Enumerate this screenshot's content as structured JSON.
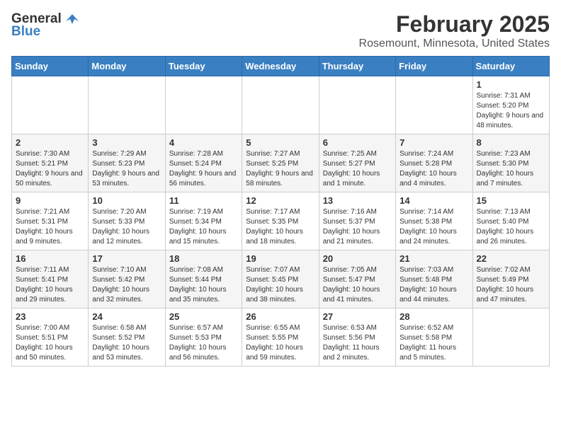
{
  "logo": {
    "general": "General",
    "blue": "Blue"
  },
  "title": "February 2025",
  "subtitle": "Rosemount, Minnesota, United States",
  "days_of_week": [
    "Sunday",
    "Monday",
    "Tuesday",
    "Wednesday",
    "Thursday",
    "Friday",
    "Saturday"
  ],
  "weeks": [
    [
      {
        "day": "",
        "info": ""
      },
      {
        "day": "",
        "info": ""
      },
      {
        "day": "",
        "info": ""
      },
      {
        "day": "",
        "info": ""
      },
      {
        "day": "",
        "info": ""
      },
      {
        "day": "",
        "info": ""
      },
      {
        "day": "1",
        "info": "Sunrise: 7:31 AM\nSunset: 5:20 PM\nDaylight: 9 hours and 48 minutes."
      }
    ],
    [
      {
        "day": "2",
        "info": "Sunrise: 7:30 AM\nSunset: 5:21 PM\nDaylight: 9 hours and 50 minutes."
      },
      {
        "day": "3",
        "info": "Sunrise: 7:29 AM\nSunset: 5:23 PM\nDaylight: 9 hours and 53 minutes."
      },
      {
        "day": "4",
        "info": "Sunrise: 7:28 AM\nSunset: 5:24 PM\nDaylight: 9 hours and 56 minutes."
      },
      {
        "day": "5",
        "info": "Sunrise: 7:27 AM\nSunset: 5:25 PM\nDaylight: 9 hours and 58 minutes."
      },
      {
        "day": "6",
        "info": "Sunrise: 7:25 AM\nSunset: 5:27 PM\nDaylight: 10 hours and 1 minute."
      },
      {
        "day": "7",
        "info": "Sunrise: 7:24 AM\nSunset: 5:28 PM\nDaylight: 10 hours and 4 minutes."
      },
      {
        "day": "8",
        "info": "Sunrise: 7:23 AM\nSunset: 5:30 PM\nDaylight: 10 hours and 7 minutes."
      }
    ],
    [
      {
        "day": "9",
        "info": "Sunrise: 7:21 AM\nSunset: 5:31 PM\nDaylight: 10 hours and 9 minutes."
      },
      {
        "day": "10",
        "info": "Sunrise: 7:20 AM\nSunset: 5:33 PM\nDaylight: 10 hours and 12 minutes."
      },
      {
        "day": "11",
        "info": "Sunrise: 7:19 AM\nSunset: 5:34 PM\nDaylight: 10 hours and 15 minutes."
      },
      {
        "day": "12",
        "info": "Sunrise: 7:17 AM\nSunset: 5:35 PM\nDaylight: 10 hours and 18 minutes."
      },
      {
        "day": "13",
        "info": "Sunrise: 7:16 AM\nSunset: 5:37 PM\nDaylight: 10 hours and 21 minutes."
      },
      {
        "day": "14",
        "info": "Sunrise: 7:14 AM\nSunset: 5:38 PM\nDaylight: 10 hours and 24 minutes."
      },
      {
        "day": "15",
        "info": "Sunrise: 7:13 AM\nSunset: 5:40 PM\nDaylight: 10 hours and 26 minutes."
      }
    ],
    [
      {
        "day": "16",
        "info": "Sunrise: 7:11 AM\nSunset: 5:41 PM\nDaylight: 10 hours and 29 minutes."
      },
      {
        "day": "17",
        "info": "Sunrise: 7:10 AM\nSunset: 5:42 PM\nDaylight: 10 hours and 32 minutes."
      },
      {
        "day": "18",
        "info": "Sunrise: 7:08 AM\nSunset: 5:44 PM\nDaylight: 10 hours and 35 minutes."
      },
      {
        "day": "19",
        "info": "Sunrise: 7:07 AM\nSunset: 5:45 PM\nDaylight: 10 hours and 38 minutes."
      },
      {
        "day": "20",
        "info": "Sunrise: 7:05 AM\nSunset: 5:47 PM\nDaylight: 10 hours and 41 minutes."
      },
      {
        "day": "21",
        "info": "Sunrise: 7:03 AM\nSunset: 5:48 PM\nDaylight: 10 hours and 44 minutes."
      },
      {
        "day": "22",
        "info": "Sunrise: 7:02 AM\nSunset: 5:49 PM\nDaylight: 10 hours and 47 minutes."
      }
    ],
    [
      {
        "day": "23",
        "info": "Sunrise: 7:00 AM\nSunset: 5:51 PM\nDaylight: 10 hours and 50 minutes."
      },
      {
        "day": "24",
        "info": "Sunrise: 6:58 AM\nSunset: 5:52 PM\nDaylight: 10 hours and 53 minutes."
      },
      {
        "day": "25",
        "info": "Sunrise: 6:57 AM\nSunset: 5:53 PM\nDaylight: 10 hours and 56 minutes."
      },
      {
        "day": "26",
        "info": "Sunrise: 6:55 AM\nSunset: 5:55 PM\nDaylight: 10 hours and 59 minutes."
      },
      {
        "day": "27",
        "info": "Sunrise: 6:53 AM\nSunset: 5:56 PM\nDaylight: 11 hours and 2 minutes."
      },
      {
        "day": "28",
        "info": "Sunrise: 6:52 AM\nSunset: 5:58 PM\nDaylight: 11 hours and 5 minutes."
      },
      {
        "day": "",
        "info": ""
      }
    ]
  ]
}
